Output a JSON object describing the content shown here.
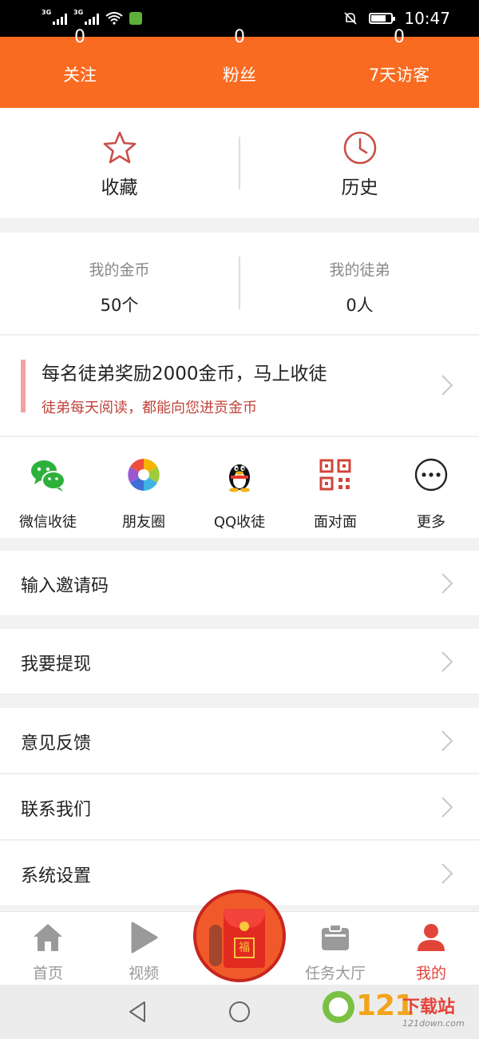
{
  "status_bar": {
    "signal1": "3G",
    "signal2": "3G",
    "time": "10:47",
    "battery_level": 0.75
  },
  "header": {
    "stats": [
      {
        "value": "0",
        "label": "关注"
      },
      {
        "value": "0",
        "label": "粉丝"
      },
      {
        "value": "0",
        "label": "7天访客"
      }
    ]
  },
  "shortcuts": [
    {
      "label": "收藏",
      "icon": "star-icon"
    },
    {
      "label": "历史",
      "icon": "clock-icon"
    }
  ],
  "accounts": [
    {
      "label": "我的金币",
      "value": "50个"
    },
    {
      "label": "我的徒弟",
      "value": "0人"
    }
  ],
  "promo": {
    "title": "每名徒弟奖励2000金币，马上收徒",
    "subtitle": "徒弟每天阅读，都能向您进贡金币"
  },
  "share": [
    {
      "label": "微信收徒",
      "icon": "wechat-icon"
    },
    {
      "label": "朋友圈",
      "icon": "moments-icon"
    },
    {
      "label": "QQ收徒",
      "icon": "qq-penguin-icon"
    },
    {
      "label": "面对面",
      "icon": "qrcode-icon"
    },
    {
      "label": "更多",
      "icon": "more-icon"
    }
  ],
  "menu": [
    {
      "label": "输入邀请码"
    },
    {
      "label": "我要提现"
    },
    {
      "label": "意见反馈"
    },
    {
      "label": "联系我们"
    },
    {
      "label": "系统设置"
    }
  ],
  "tabbar": {
    "tabs": [
      {
        "label": "首页",
        "icon": "home-icon"
      },
      {
        "label": "视频",
        "icon": "play-icon"
      },
      {
        "label": "任务大厅",
        "icon": "task-icon"
      },
      {
        "label": "我的",
        "icon": "user-icon"
      }
    ],
    "center_badge": "福",
    "active_color": "#e3443a"
  },
  "watermark": {
    "number": "121",
    "text": "下载站",
    "url": "121down.com"
  },
  "colors": {
    "brand_orange": "#f96b21",
    "accent_red": "#c0443b"
  }
}
